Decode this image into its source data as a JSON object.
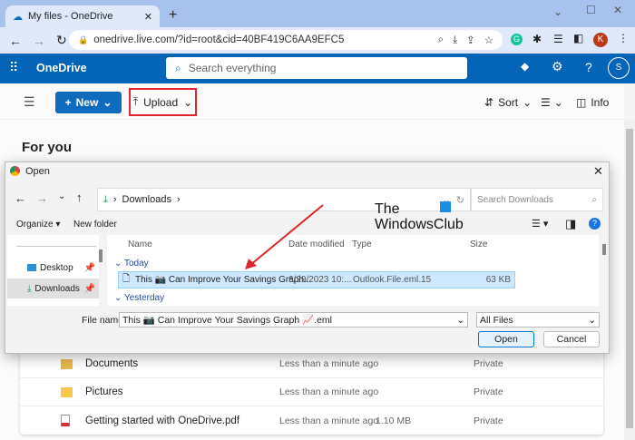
{
  "browser": {
    "tab_title": "My files - OneDrive",
    "url": "onedrive.live.com/?id=root&cid=40BF419C6AA9EFC5",
    "profile_initial": "K"
  },
  "onedrive": {
    "app_name": "OneDrive",
    "search_placeholder": "Search everything",
    "account_initial": "S",
    "brand_color": "#0364b8"
  },
  "toolbar": {
    "new_label": "New",
    "upload_label": "Upload",
    "sort_label": "Sort",
    "info_label": "Info"
  },
  "main": {
    "heading": "For you",
    "files": [
      {
        "name": "Documents",
        "modified": "Less than a minute ago",
        "size": "",
        "sharing": "Private",
        "icon": "folder-icon"
      },
      {
        "name": "Pictures",
        "modified": "Less than a minute ago",
        "size": "",
        "sharing": "Private",
        "icon": "folder-icon"
      },
      {
        "name": "Getting started with OneDrive.pdf",
        "modified": "Less than a minute ago",
        "size": "1.10 MB",
        "sharing": "Private",
        "icon": "pdf-icon"
      }
    ]
  },
  "dialog": {
    "title": "Open",
    "breadcrumb": "Downloads",
    "search_placeholder": "Search Downloads",
    "organize": "Organize",
    "new_folder": "New folder",
    "nav": [
      {
        "label": "Desktop"
      },
      {
        "label": "Downloads"
      }
    ],
    "columns": [
      "Name",
      "Date modified",
      "Type",
      "Size"
    ],
    "groups": [
      "Today",
      "Yesterday"
    ],
    "selected_file": {
      "name": "This 📷 Can Improve Your Savings Graph...",
      "date": "6/29/2023 10:...",
      "type": "Outlook.File.eml.15",
      "size": "63 KB"
    },
    "file_name_label": "File name:",
    "file_name_value": "This 📷 Can Improve Your Savings Graph 📈.eml",
    "file_type": "All Files",
    "open_label": "Open",
    "cancel_label": "Cancel"
  },
  "watermark": {
    "line1": "The",
    "line2": "WindowsClub"
  },
  "annotation_color": "#e0262b"
}
